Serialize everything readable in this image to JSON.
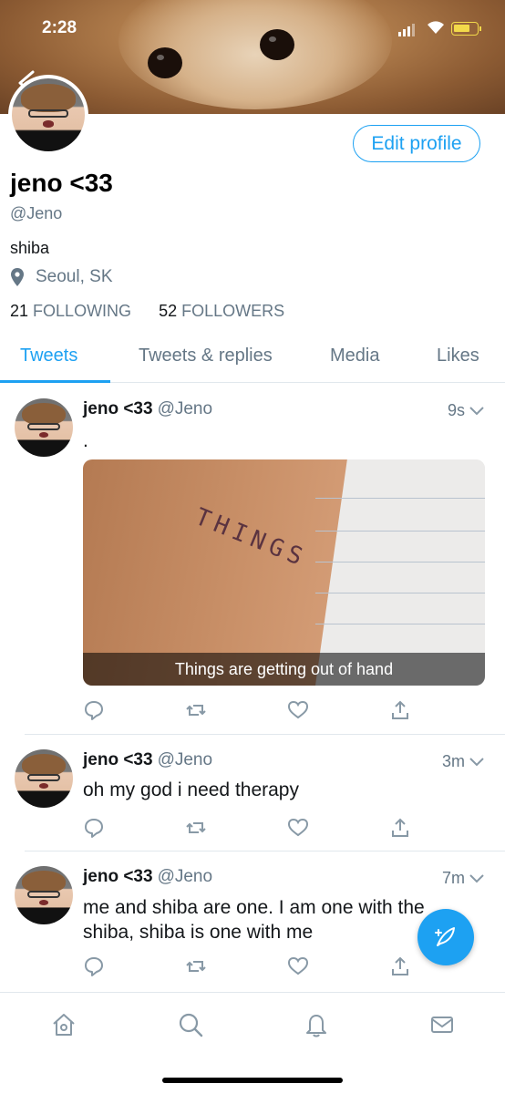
{
  "status_bar": {
    "time": "2:28"
  },
  "profile": {
    "display_name": "jeno <33",
    "handle": "@Jeno",
    "bio": "shiba",
    "location": "Seoul, SK",
    "following_count": "21",
    "following_label": "FOLLOWING",
    "followers_count": "52",
    "followers_label": "FOLLOWERS",
    "edit_button": "Edit profile"
  },
  "tabs": [
    {
      "label": "Tweets",
      "active": true
    },
    {
      "label": "Tweets & replies",
      "active": false
    },
    {
      "label": "Media",
      "active": false
    },
    {
      "label": "Likes",
      "active": false
    }
  ],
  "tweets": [
    {
      "name": "jeno <33",
      "handle": "@Jeno",
      "time": "9s",
      "text": ".",
      "media_caption": "Things are getting out of hand",
      "media_handwriting": "THINGS"
    },
    {
      "name": "jeno <33",
      "handle": "@Jeno",
      "time": "3m",
      "text": "oh my god i need therapy"
    },
    {
      "name": "jeno <33",
      "handle": "@Jeno",
      "time": "7m",
      "text": "me and shiba are one. I am one with the shiba, shiba is one with me"
    }
  ],
  "bottom_nav": [
    "home-icon",
    "search-icon",
    "notifications-icon",
    "messages-icon"
  ],
  "colors": {
    "accent": "#1da1f2",
    "secondary_text": "#657786",
    "divider": "#e1e8ed"
  }
}
